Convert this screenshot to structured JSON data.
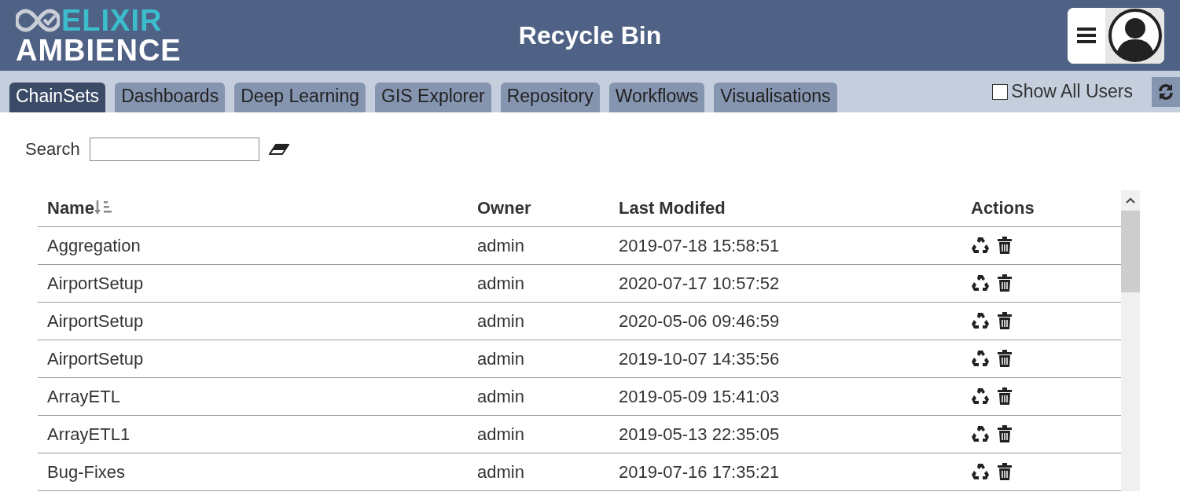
{
  "logo": {
    "line_1": "ELIXIR",
    "line_2": "AMBIENCE"
  },
  "title": "Recycle Bin",
  "tabs": [
    {
      "label": "ChainSets",
      "selected": true
    },
    {
      "label": "Dashboards",
      "selected": false
    },
    {
      "label": "Deep Learning",
      "selected": false
    },
    {
      "label": "GIS Explorer",
      "selected": false
    },
    {
      "label": "Repository",
      "selected": false
    },
    {
      "label": "Workflows",
      "selected": false
    },
    {
      "label": "Visualisations",
      "selected": false
    }
  ],
  "show_all_users": {
    "label": "Show All Users",
    "checked": false
  },
  "search": {
    "label": "Search"
  },
  "table": {
    "columns": [
      "Name",
      "Owner",
      "Last Modifed",
      "Actions"
    ],
    "rows": [
      {
        "name": "Aggregation",
        "owner": "admin",
        "modified": "2019-07-18 15:58:51"
      },
      {
        "name": "AirportSetup",
        "owner": "admin",
        "modified": "2020-07-17 10:57:52"
      },
      {
        "name": "AirportSetup",
        "owner": "admin",
        "modified": "2020-05-06 09:46:59"
      },
      {
        "name": "AirportSetup",
        "owner": "admin",
        "modified": "2019-10-07 14:35:56"
      },
      {
        "name": "ArrayETL",
        "owner": "admin",
        "modified": "2019-05-09 15:41:03"
      },
      {
        "name": "ArrayETL1",
        "owner": "admin",
        "modified": "2019-05-13 22:35:05"
      },
      {
        "name": "Bug-Fixes",
        "owner": "admin",
        "modified": "2019-07-16 17:35:21"
      }
    ]
  }
}
